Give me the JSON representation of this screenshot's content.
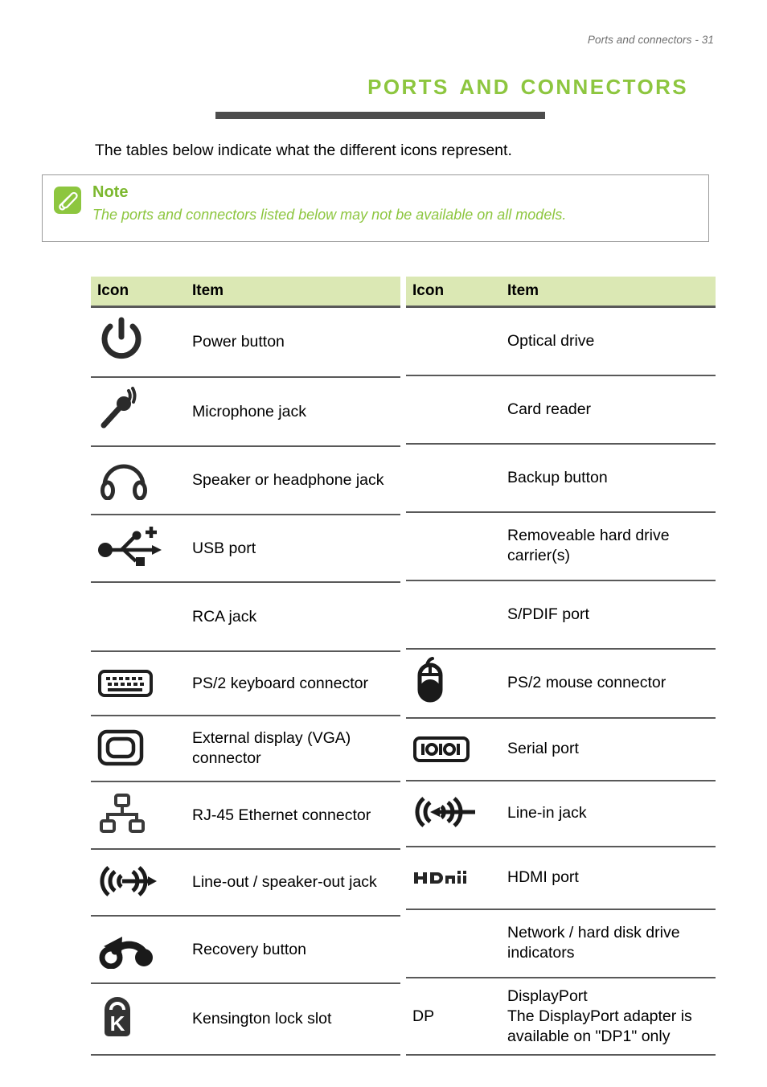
{
  "page": {
    "running_header": "Ports and connectors - 31",
    "chapter_title": "Ports and connectors",
    "intro": "The tables below indicate what the different icons represent."
  },
  "note": {
    "icon": "paperclip-icon",
    "title": "Note",
    "text": "The ports and connectors listed below may not be available on all models.",
    "accent_color": "#8dc63f",
    "border_color": "#9a9a9a"
  },
  "colors": {
    "title_green": "#8dc63f",
    "header_row_green": "#dbe8b4",
    "rule_gray": "#4d4d4d",
    "row_border_gray": "#595959",
    "header_text_gray": "#6f6f6f"
  },
  "tables": [
    {
      "headers": {
        "icon": "Icon",
        "item": "Item"
      },
      "rows": [
        {
          "icon": "power-button-icon",
          "item": "Power button"
        },
        {
          "icon": "microphone-jack-icon",
          "item": "Microphone jack"
        },
        {
          "icon": "headphone-jack-icon",
          "item": "Speaker or headphone jack"
        },
        {
          "icon": "usb-port-icon",
          "item": "USB port"
        },
        {
          "icon": "",
          "item": "RCA jack"
        },
        {
          "icon": "ps2-keyboard-icon",
          "item": "PS/2 keyboard connector"
        },
        {
          "icon": "vga-display-icon",
          "item": "External display (VGA) connector"
        },
        {
          "icon": "rj45-ethernet-icon",
          "item": "RJ-45 Ethernet connector"
        },
        {
          "icon": "line-out-jack-icon",
          "item": "Line-out / speaker-out jack"
        },
        {
          "icon": "recovery-button-icon",
          "item": "Recovery button"
        },
        {
          "icon": "kensington-lock-icon",
          "item": "Kensington lock slot"
        }
      ]
    },
    {
      "headers": {
        "icon": "Icon",
        "item": "Item"
      },
      "rows": [
        {
          "icon": "",
          "item": "Optical drive"
        },
        {
          "icon": "",
          "item": "Card reader"
        },
        {
          "icon": "",
          "item": "Backup button"
        },
        {
          "icon": "",
          "item": "Removeable hard drive carrier(s)"
        },
        {
          "icon": "",
          "item": "S/PDIF port"
        },
        {
          "icon": "ps2-mouse-icon",
          "item": "PS/2 mouse connector"
        },
        {
          "icon": "serial-port-icon",
          "item": "Serial port"
        },
        {
          "icon": "line-in-jack-icon",
          "item": "Line-in jack"
        },
        {
          "icon": "hdmi-port-icon",
          "item": "HDMI port"
        },
        {
          "icon": "",
          "item": "Network / hard disk drive indicators"
        },
        {
          "icon": "dp-text-label",
          "icon_text": "DP",
          "item": "DisplayPort\nThe DisplayPort adapter is available on \"DP1\" only"
        }
      ]
    }
  ]
}
